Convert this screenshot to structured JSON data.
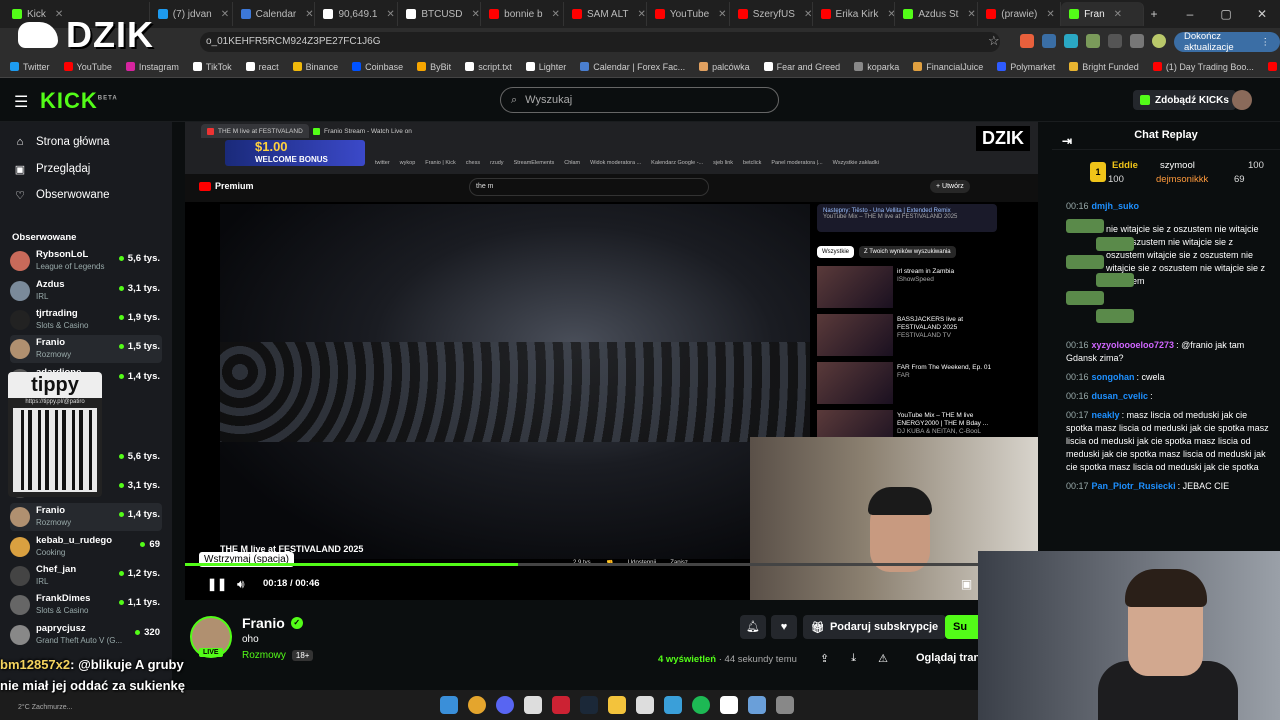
{
  "browser": {
    "tabs": [
      {
        "label": "Kick",
        "color": "#53fc18"
      },
      {
        "label": "(7) jdvan",
        "color": "#1d9bf0"
      },
      {
        "label": "Calendar",
        "color": "#3c78d8"
      },
      {
        "label": "90,649.1",
        "color": "#ffffff"
      },
      {
        "label": "BTCUSD",
        "color": "#ffffff"
      },
      {
        "label": "bonnie b",
        "color": "#ff0000"
      },
      {
        "label": "SAM ALT",
        "color": "#ff0000"
      },
      {
        "label": "YouTube",
        "color": "#ff0000"
      },
      {
        "label": "SzeryfUS",
        "color": "#ff0000"
      },
      {
        "label": "Erika Kirk",
        "color": "#ff0000"
      },
      {
        "label": "Azdus St",
        "color": "#53fc18"
      },
      {
        "label": "(prawie)",
        "color": "#ff0000"
      },
      {
        "label": "Fran",
        "color": "#53fc18"
      }
    ],
    "url": "o_01KEHFR5RCM924Z3PE27FC1J6G",
    "finish_update": "Dokończ aktualizacje",
    "bookmarks": [
      {
        "label": "Twitter",
        "color": "#1d9bf0"
      },
      {
        "label": "YouTube",
        "color": "#ff0000"
      },
      {
        "label": "Instagram",
        "color": "#d6249f"
      },
      {
        "label": "TikTok",
        "color": "#ffffff"
      },
      {
        "label": "react",
        "color": "#ffffff"
      },
      {
        "label": "Binance",
        "color": "#f0b90b"
      },
      {
        "label": "Coinbase",
        "color": "#0052ff"
      },
      {
        "label": "ByBit",
        "color": "#f7a600"
      },
      {
        "label": "script.txt",
        "color": "#ffffff"
      },
      {
        "label": "Lighter",
        "color": "#ffffff"
      },
      {
        "label": "Calendar | Forex Fac...",
        "color": "#4a7fd0"
      },
      {
        "label": "palcówka",
        "color": "#e0a060"
      },
      {
        "label": "Fear and Greed",
        "color": "#ffffff"
      },
      {
        "label": "koparka",
        "color": "#888888"
      },
      {
        "label": "FinancialJuice",
        "color": "#e0a040"
      },
      {
        "label": "Polymarket",
        "color": "#2e5bff"
      },
      {
        "label": "Bright Funded",
        "color": "#e8b430"
      },
      {
        "label": "(1) Day Trading Boo...",
        "color": "#ff0000"
      },
      {
        "label": "BTC Elliot wave",
        "color": "#ff0000"
      }
    ]
  },
  "overlay": {
    "logo": "DZIK"
  },
  "header": {
    "logo": "KICK",
    "logo_tag": "BETA",
    "search_placeholder": "Wyszukaj",
    "get_kicks": "Zdobądź KICKs"
  },
  "sidebar": {
    "nav": [
      {
        "label": "Strona główna",
        "icon": "⌂"
      },
      {
        "label": "Przeglądaj",
        "icon": "▣"
      },
      {
        "label": "Obserwowane",
        "icon": "♡"
      }
    ],
    "section": "Obserwowane",
    "followed": [
      {
        "name": "RybsonLoL",
        "category": "League of Legends",
        "viewers": "5,6 tys.",
        "color": "#c96a5a"
      },
      {
        "name": "Azdus",
        "category": "IRL",
        "viewers": "3,1 tys.",
        "color": "#7a8a9a"
      },
      {
        "name": "tjrtrading",
        "category": "Slots & Casino",
        "viewers": "1,9 tys.",
        "color": "#222222"
      },
      {
        "name": "Franio",
        "category": "Rozmowy",
        "viewers": "1,5 tys.",
        "color": "#b09070"
      },
      {
        "name": "adardione",
        "category": "",
        "viewers": "1,4 tys.",
        "color": "#555555"
      },
      {
        "name": "",
        "category": "",
        "viewers": "5,6 tys.",
        "color": "#444444"
      },
      {
        "name": "",
        "category": "",
        "viewers": "3,1 tys.",
        "color": "#444444"
      },
      {
        "name": "Franio",
        "category": "Rozmowy",
        "viewers": "1,4 tys.",
        "color": "#b09070"
      },
      {
        "name": "kebab_u_rudego",
        "category": "Cooking",
        "viewers": "69",
        "color": "#d9a040"
      },
      {
        "name": "Chef_jan",
        "category": "IRL",
        "viewers": "1,2 tys.",
        "color": "#444444"
      },
      {
        "name": "FrankDimes",
        "category": "Slots & Casino",
        "viewers": "1,1 tys.",
        "color": "#666666"
      },
      {
        "name": "paprycjusz",
        "category": "Grand Theft Auto V (G...",
        "viewers": "320",
        "color": "#888888"
      }
    ],
    "tippy": {
      "logo": "tippy",
      "url": "https://tippy.pl/@patiro"
    },
    "chat_overlay": {
      "user": "bm12857x2",
      "text": ": @blikuje A gruby nie miał jej oddać za sukienkę"
    }
  },
  "video": {
    "inner_tabs": [
      {
        "label": "THE M live at FESTIVALAND"
      },
      {
        "label": "Franio Stream - Watch Live on"
      }
    ],
    "bonus_amount": "$1.00",
    "bonus_label": "WELCOME BONUS",
    "inner_bookmarks": [
      "twitter",
      "wykop",
      "Franio | Kick",
      "chess",
      "rzudy",
      "StreamElements",
      "Chłam",
      "Widok moderatora ...",
      "Kalendarz Google -...",
      "sjeb link",
      "betclick",
      "Panel moderatora |...",
      "Wszystkie zakładki"
    ],
    "dzik_logo": "DZIK",
    "yt_logo": "Premium",
    "yt_search": "the m",
    "yt_create": "+ Utwórz",
    "next_up": "Następny: Tiësto - Una Vellita | Extended Remix",
    "next_up_sub": "YouTube Mix – THE M live at FESTIVALAND 2025",
    "chips": [
      "Wszystkie",
      "Z Twoich wyników wyszukiwania"
    ],
    "yt_list": [
      {
        "title": "irl stream in Zambia",
        "meta": "IShowSpeed"
      },
      {
        "title": "BASSJACKERS live at FESTIVALAND 2025",
        "meta": "FESTIVALAND TV"
      },
      {
        "title": "FAR From The Weekend, Ep. 01",
        "meta": "FAR"
      },
      {
        "title": "YouTube Mix – THE M live ENERGY2000 | THE M Bday ...",
        "meta": "DJ KUBA & NEITAN, C-BooL"
      }
    ],
    "title": "THE M live at FESTIVALAND 2025",
    "tooltip": "Wstrzymaj (spacja)",
    "current": "00:18",
    "duration": "00:46",
    "progress": 0.39,
    "yt_actions": [
      "2,9 tys.",
      "",
      "Udostępnij",
      "Zapisz"
    ]
  },
  "stream": {
    "channel": "Franio",
    "title": "oho",
    "category": "Rozmowy",
    "age": "18+",
    "live": "LIVE",
    "gift_sub": "Podaruj subskrypcje",
    "subscribe": "Su",
    "views": "4 wyświetleń",
    "ago": "44 sekundy temu",
    "watch_translated": "Oglądaj tran"
  },
  "chat": {
    "title": "Chat Replay",
    "leaderboard": [
      {
        "name": "Eddie",
        "value": "100",
        "rank": "1"
      },
      {
        "name": "szymool",
        "value": "100"
      },
      {
        "name": "dejmsonikkk",
        "value": "69"
      }
    ],
    "leader_first_sub": "100",
    "messages": [
      {
        "time": "00:16",
        "user": "dmjh_suko",
        "text": "",
        "color": "#1e90ff"
      },
      {
        "time": "",
        "user": "",
        "text": "nie witajcie sie z oszustem nie witajcie sie z oszustem nie witajcie sie z oszustem witajcie sie z oszustem nie witajcie sie z oszustem nie witajcie sie z oszustem",
        "color": "#ffffff"
      },
      {
        "time": "00:16",
        "user": "xyzyoloooeloo7273",
        "text": ": @franio jak tam Gdansk zima?",
        "color": "#d066ff"
      },
      {
        "time": "00:16",
        "user": "songohan",
        "text": ": cwela",
        "color": "#1e90ff"
      },
      {
        "time": "00:16",
        "user": "dusan_cvelic",
        "text": ":",
        "color": "#1e90ff"
      },
      {
        "time": "00:17",
        "user": "neakly",
        "text": ": masz liscia od meduski jak cie spotka masz liscia od meduski jak cie spotka masz liscia od meduski jak cie spotka masz liscia od meduski jak cie spotka masz liscia od meduski jak cie spotka masz liscia od meduski jak cie spotka",
        "color": "#1e90ff"
      },
      {
        "time": "00:17",
        "user": "Pan_Piotr_Rusiecki",
        "text": ": JEBAC CIE",
        "color": "#1e90ff"
      }
    ]
  },
  "taskbar": {
    "weather": "2°C\nZachmurze..."
  }
}
